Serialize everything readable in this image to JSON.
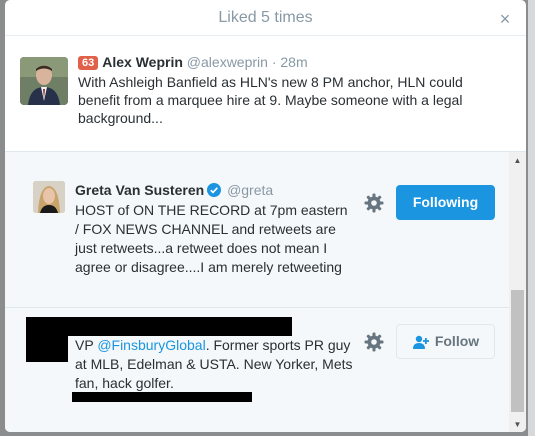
{
  "modal": {
    "title": "Liked 5 times",
    "close_glyph": "×"
  },
  "tweet": {
    "rank_badge": "63",
    "name": "Alex Weprin",
    "handle": "@alexweprin",
    "separator": "·",
    "time": "28m",
    "text": "With Ashleigh Banfield as HLN's new 8 PM anchor, HLN could benefit from a marquee hire at 9. Maybe someone with a legal background..."
  },
  "users": [
    {
      "name": "Greta Van Susteren",
      "verified": true,
      "handle": "@greta",
      "bio": "HOST of ON THE RECORD at 7pm eastern / FOX NEWS CHANNEL and retweets are just retweets...a retweet does not mean I agree or disagree....I am merely retweeting",
      "button_label": "Following",
      "button_state": "following"
    },
    {
      "name": "",
      "handle": "",
      "bio_prefix": "VP ",
      "bio_mention": "@FinsburyGlobal",
      "bio_rest": ". Former sports PR guy at MLB, Edelman & USTA. New Yorker, Mets fan, hack golfer.",
      "button_label": "Follow",
      "button_state": "not-following"
    }
  ],
  "scrollbar": {
    "up_glyph": "▲",
    "down_glyph": "▼"
  },
  "colors": {
    "accent": "#1b95e0",
    "badge": "#e0604a",
    "muted": "#8899a6"
  }
}
